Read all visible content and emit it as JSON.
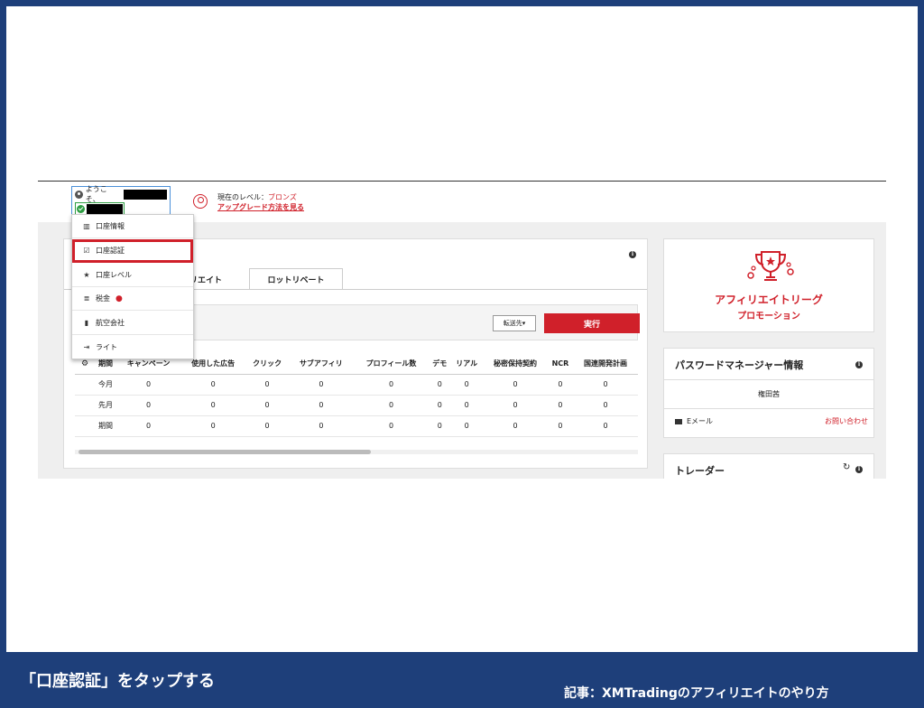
{
  "header": {
    "welcome": "ようこそ、",
    "level_label": "現在のレベル：",
    "level_value": "ブロンズ",
    "upgrade_link": "アップグレード方法を見る"
  },
  "menu": {
    "items": [
      {
        "label": "口座情報",
        "icon": "chart-icon"
      },
      {
        "label": "口座認証",
        "icon": "checkbox-icon"
      },
      {
        "label": "口座レベル",
        "icon": "star-icon"
      },
      {
        "label": "税金",
        "icon": "coins-icon"
      },
      {
        "label": "航空会社",
        "icon": "document-icon"
      },
      {
        "label": "ライト",
        "icon": "logout-icon"
      }
    ]
  },
  "tabs": [
    "リエイト",
    "ロットリベート"
  ],
  "filter": {
    "dest_button": "転送先",
    "run_button": "実行"
  },
  "table": {
    "headers": [
      "期間",
      "キャンペーン",
      "使用した広告",
      "クリック",
      "サブアフィリ",
      "プロフィール数",
      "デモ",
      "リアル",
      "秘密保持契約",
      "NCR",
      "国連開発計画"
    ],
    "rows": [
      [
        "今月",
        "0",
        "0",
        "0",
        "0",
        "0",
        "0",
        "0",
        "0",
        "0",
        "0"
      ],
      [
        "先月",
        "0",
        "0",
        "0",
        "0",
        "0",
        "0",
        "0",
        "0",
        "0",
        "0"
      ],
      [
        "期間",
        "0",
        "0",
        "0",
        "0",
        "0",
        "0",
        "0",
        "0",
        "0",
        "0"
      ]
    ]
  },
  "promo": {
    "title": "アフィリエイトリーグ",
    "subtitle": "プロモーション"
  },
  "manager": {
    "title": "パスワードマネージャー情報",
    "name": "権田茜",
    "email_label": "Eメール",
    "contact_link": "お問い合わせ"
  },
  "trader": {
    "title": "トレーダー"
  },
  "captions": {
    "instruction": "「口座認証」をタップする",
    "article": "記事：XMTradingのアフィリエイトのやり方"
  },
  "colors": {
    "brand_red": "#d0202a",
    "frame_blue": "#1e3f7a"
  }
}
